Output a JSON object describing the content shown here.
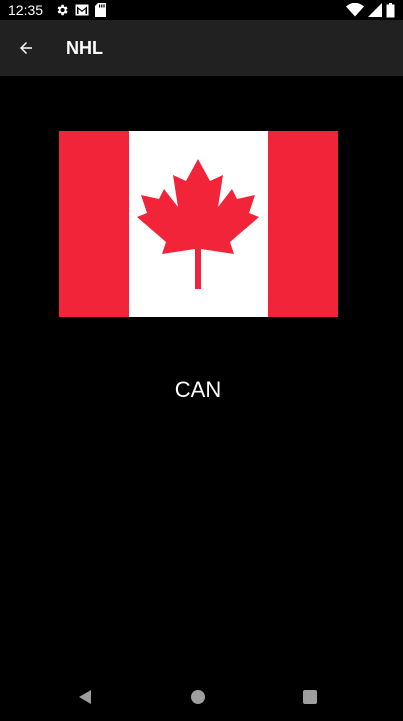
{
  "status_bar": {
    "time": "12:35",
    "left_icons": [
      "settings-icon",
      "gmail-icon",
      "sd-card-icon"
    ],
    "right_icons": [
      "wifi-icon",
      "signal-icon",
      "battery-icon"
    ]
  },
  "app_bar": {
    "back_icon": "arrow-back-icon",
    "title": "NHL"
  },
  "content": {
    "flag_name": "canada-flag",
    "country_code": "CAN",
    "colors": {
      "flag_red": "#f1243a",
      "flag_white": "#ffffff"
    }
  },
  "nav_bar": {
    "buttons": [
      "back-triangle-icon",
      "home-circle-icon",
      "recents-square-icon"
    ]
  },
  "colors": {
    "background": "#000000",
    "app_bar": "#212121",
    "text": "#ffffff",
    "nav_icons": "#9e9e9e"
  }
}
